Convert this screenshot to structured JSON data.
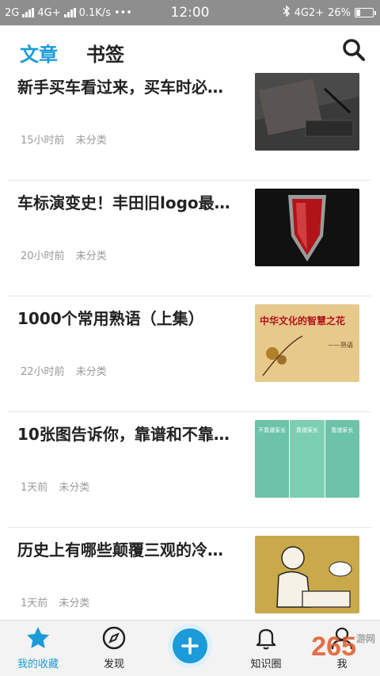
{
  "status_bar": {
    "network_1": "2G",
    "network_2": "4G+",
    "speed": "0.1K/s",
    "more": "•••",
    "time": "12:00",
    "network_3": "4G2+",
    "battery": "26%"
  },
  "header": {
    "tab_articles": "文章",
    "tab_bookmarks": "书签"
  },
  "articles": [
    {
      "title": "新手买车看过来，买车时必…",
      "time": "15小时前",
      "category": "未分类"
    },
    {
      "title": "车标演变史！丰田旧logo最…",
      "time": "20小时前",
      "category": "未分类"
    },
    {
      "title": "1000个常用熟语（上集）",
      "time": "22小时前",
      "category": "未分类",
      "thumb_text": "中华文化的智慧之花",
      "thumb_sub": "——熟语"
    },
    {
      "title": "10张图告诉你，靠谱和不靠…",
      "time": "1天前",
      "category": "未分类",
      "thumb_cols": [
        "不靠谱家长",
        "靠谱家长",
        "靠谱家长"
      ]
    },
    {
      "title": "历史上有哪些颠覆三观的冷…",
      "time": "1天前",
      "category": "未分类"
    }
  ],
  "bottom_nav": {
    "favorites": "我的收藏",
    "discover": "发现",
    "knowledge": "知识圈",
    "me": "我"
  },
  "watermark": {
    "brand": "265",
    "sub": "游网"
  },
  "colors": {
    "accent": "#1b9bd8",
    "statusbar": "#8e8e8e"
  }
}
